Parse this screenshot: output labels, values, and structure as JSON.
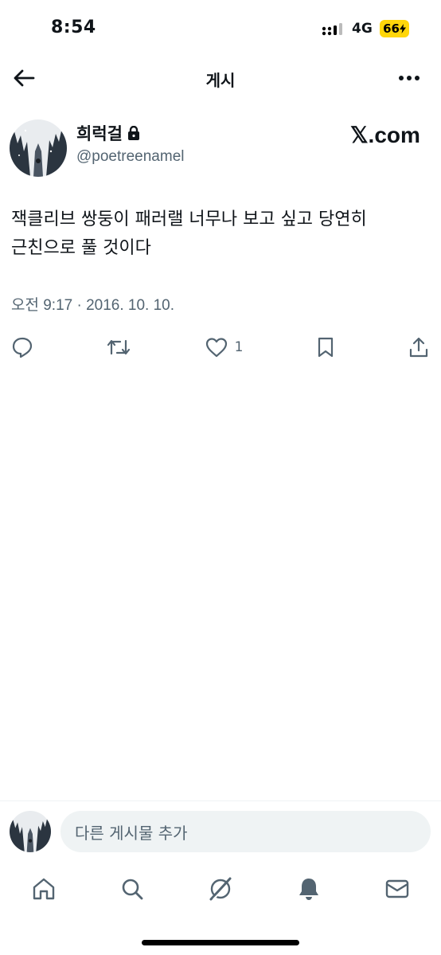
{
  "status_bar": {
    "time": "8:54",
    "network": "4G",
    "battery": "66"
  },
  "header": {
    "title": "게시"
  },
  "post": {
    "author_name": "희럭걸",
    "handle": "@poetreenamel",
    "brand": "𝕏.com",
    "text": "잭클리브 쌍둥이 패러랠 너무나 보고 싶고 당연히\n근친으로 풀 것이다",
    "timestamp": "오전 9:17 · 2016. 10. 10.",
    "like_count": "1"
  },
  "reply": {
    "placeholder": "다른 게시물 추가"
  },
  "icons": {
    "back": "arrow-left-icon",
    "more": "more-icon",
    "lock": "lock-icon",
    "reply": "reply-icon",
    "retweet": "retweet-icon",
    "like": "heart-icon",
    "bookmark": "bookmark-icon",
    "share": "share-icon",
    "home": "home-icon",
    "search": "search-icon",
    "grok": "grok-icon",
    "notifications": "bell-icon",
    "messages": "mail-icon"
  },
  "colors": {
    "text": "#0f1419",
    "secondary": "#536471",
    "battery": "#ffd60a",
    "input_bg": "#eff3f4"
  }
}
